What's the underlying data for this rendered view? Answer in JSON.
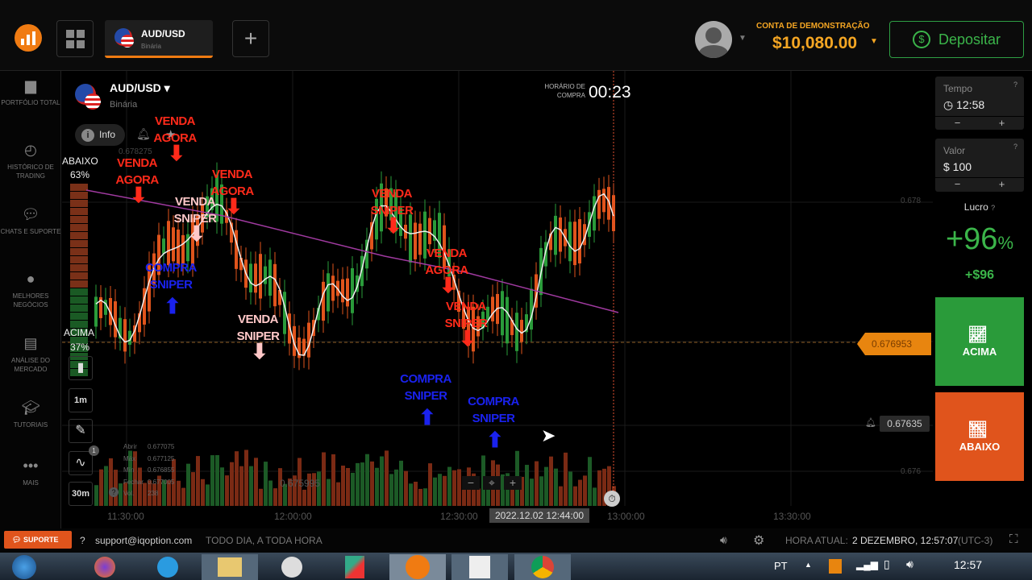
{
  "header": {
    "asset_tab": "AUD/USD",
    "asset_tab_sub": "Binária",
    "account_label": "CONTA DE DEMONSTRAÇÃO",
    "balance": "$10,080.00",
    "deposit_label": "Depositar"
  },
  "sidebar": {
    "items": [
      {
        "label": "PORTFÓLIO TOTAL",
        "icon": "briefcase-icon"
      },
      {
        "label": "HISTÓRICO DE TRADING",
        "icon": "history-icon"
      },
      {
        "label": "CHATS E SUPORTE",
        "icon": "chat-icon"
      },
      {
        "label": "MELHORES NEGÓCIOS",
        "icon": "award-icon"
      },
      {
        "label": "ANÁLISE DO MERCADO",
        "icon": "news-icon"
      },
      {
        "label": "TUTORIAIS",
        "icon": "graduation-icon"
      },
      {
        "label": "MAIS",
        "icon": "more-icon"
      }
    ]
  },
  "chart": {
    "asset": "AUD/USD",
    "asset_type": "Binária",
    "info_label": "Info",
    "top_price": "0.678275",
    "purchase_time_label": "HORÁRIO DE COMPRA",
    "countdown": "00:23",
    "abaixo_label": "ABAIXO",
    "abaixo_pct": "63%",
    "acima_label": "ACIMA",
    "acima_pct": "37%",
    "price_levels": [
      "0.678",
      "0.676"
    ],
    "current_price": "0.676953",
    "alert_price": "0.67635",
    "mid_price": "0.675995",
    "time_labels": [
      "11:30:00",
      "12:00:00",
      "12:30:00",
      "13:00:00",
      "13:30:00"
    ],
    "cursor_time": "2022.12.02 12:44:00",
    "tools": [
      "1m",
      "30m"
    ],
    "indicator_badge": "1",
    "ohlc": {
      "labels": [
        "Abrir",
        "Máx",
        "Mín",
        "Fechar",
        "Vol."
      ],
      "values": [
        "0.677075",
        "0.677125",
        "0.676855",
        "0.677005",
        "238"
      ]
    },
    "annotations": [
      {
        "text": "VENDA AGORA",
        "color": "#ff2a1a",
        "dir": "down"
      },
      {
        "text": "VENDA AGORA",
        "color": "#ff2a1a",
        "dir": "down"
      },
      {
        "text": "VENDA AGORA",
        "color": "#ff2a1a",
        "dir": "down"
      },
      {
        "text": "VENDA SNIPER",
        "color": "#ffc8c8",
        "dir": "down"
      },
      {
        "text": "COMPRA SNIPER",
        "color": "#1a22ee",
        "dir": "up"
      },
      {
        "text": "VENDA SNIPER",
        "color": "#ffc8c8",
        "dir": "down"
      },
      {
        "text": "VENDA SNIPER",
        "color": "#ff2a1a",
        "dir": "down"
      },
      {
        "text": "VENDA AGORA",
        "color": "#ff2a1a",
        "dir": "down"
      },
      {
        "text": "VENDA SNIPER",
        "color": "#ff2a1a",
        "dir": "down"
      },
      {
        "text": "COMPRA SNIPER",
        "color": "#1a22ee",
        "dir": "up"
      },
      {
        "text": "COMPRA SNIPER",
        "color": "#1a22ee",
        "dir": "up"
      }
    ]
  },
  "right_panel": {
    "time_label": "Tempo",
    "time_value": "12:58",
    "amount_label": "Valor",
    "amount_value": "$ 100",
    "profit_label": "Lucro",
    "profit_pct": "+96",
    "pct_sign": "%",
    "profit_value": "+$96",
    "up_label": "ACIMA",
    "down_label": "ABAIXO"
  },
  "footer": {
    "support_label": "SUPORTE",
    "email": "support@iqoption.com",
    "hours": "TODO DIA, A TODA HORA",
    "time_label": "HORA ATUAL:",
    "time_value": "2 DEZEMBRO, 12:57:07",
    "tz": "(UTC-3)"
  },
  "taskbar": {
    "lang": "PT",
    "clock": "12:57"
  },
  "colors": {
    "up": "#2a9b3a",
    "down": "#e0541c",
    "accent": "#f07b12",
    "balance": "#f5a623"
  }
}
